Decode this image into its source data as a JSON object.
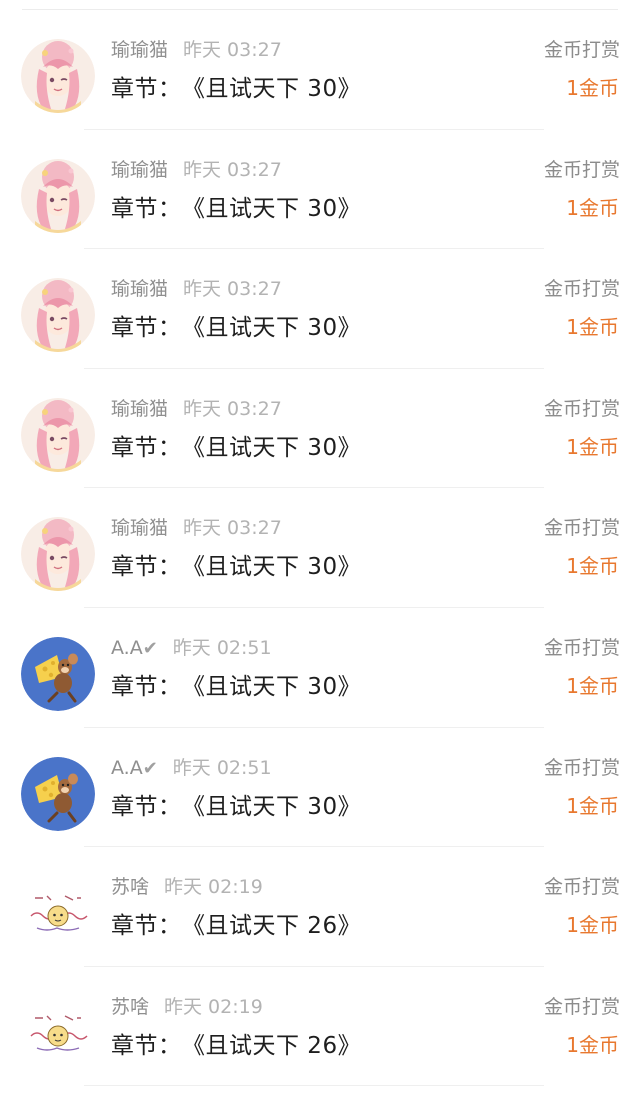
{
  "list": {
    "items": [
      {
        "username": "瑜瑜猫",
        "verified": "",
        "time": "昨天 03:27",
        "chapter_label": "章节：",
        "chapter_title": "《且试天下 30》",
        "reward_type": "金币打赏",
        "reward_amount": "1金币",
        "avatar_icon": "anime-girl-avatar"
      },
      {
        "username": "瑜瑜猫",
        "verified": "",
        "time": "昨天 03:27",
        "chapter_label": "章节：",
        "chapter_title": "《且试天下 30》",
        "reward_type": "金币打赏",
        "reward_amount": "1金币",
        "avatar_icon": "anime-girl-avatar"
      },
      {
        "username": "瑜瑜猫",
        "verified": "",
        "time": "昨天 03:27",
        "chapter_label": "章节：",
        "chapter_title": "《且试天下 30》",
        "reward_type": "金币打赏",
        "reward_amount": "1金币",
        "avatar_icon": "anime-girl-avatar"
      },
      {
        "username": "瑜瑜猫",
        "verified": "",
        "time": "昨天 03:27",
        "chapter_label": "章节：",
        "chapter_title": "《且试天下 30》",
        "reward_type": "金币打赏",
        "reward_amount": "1金币",
        "avatar_icon": "anime-girl-avatar"
      },
      {
        "username": "瑜瑜猫",
        "verified": "",
        "time": "昨天 03:27",
        "chapter_label": "章节：",
        "chapter_title": "《且试天下 30》",
        "reward_type": "金币打赏",
        "reward_amount": "1金币",
        "avatar_icon": "anime-girl-avatar"
      },
      {
        "username": "A.A",
        "verified": "✔",
        "time": "昨天 02:51",
        "chapter_label": "章节：",
        "chapter_title": "《且试天下 30》",
        "reward_type": "金币打赏",
        "reward_amount": "1金币",
        "avatar_icon": "mouse-cheese-avatar"
      },
      {
        "username": "A.A",
        "verified": "✔",
        "time": "昨天 02:51",
        "chapter_label": "章节：",
        "chapter_title": "《且试天下 30》",
        "reward_type": "金币打赏",
        "reward_amount": "1金币",
        "avatar_icon": "mouse-cheese-avatar"
      },
      {
        "username": "苏啥",
        "verified": "",
        "time": "昨天 02:19",
        "chapter_label": "章节：",
        "chapter_title": "《且试天下 26》",
        "reward_type": "金币打赏",
        "reward_amount": "1金币",
        "avatar_icon": "doodle-avatar"
      },
      {
        "username": "苏啥",
        "verified": "",
        "time": "昨天 02:19",
        "chapter_label": "章节：",
        "chapter_title": "《且试天下 26》",
        "reward_type": "金币打赏",
        "reward_amount": "1金币",
        "avatar_icon": "doodle-avatar"
      }
    ]
  },
  "colors": {
    "reward_amount": "#e8782f",
    "meta_text": "#8f8f8f",
    "time_text": "#b3b3b3",
    "avatar_blue": "#4a74c9"
  }
}
